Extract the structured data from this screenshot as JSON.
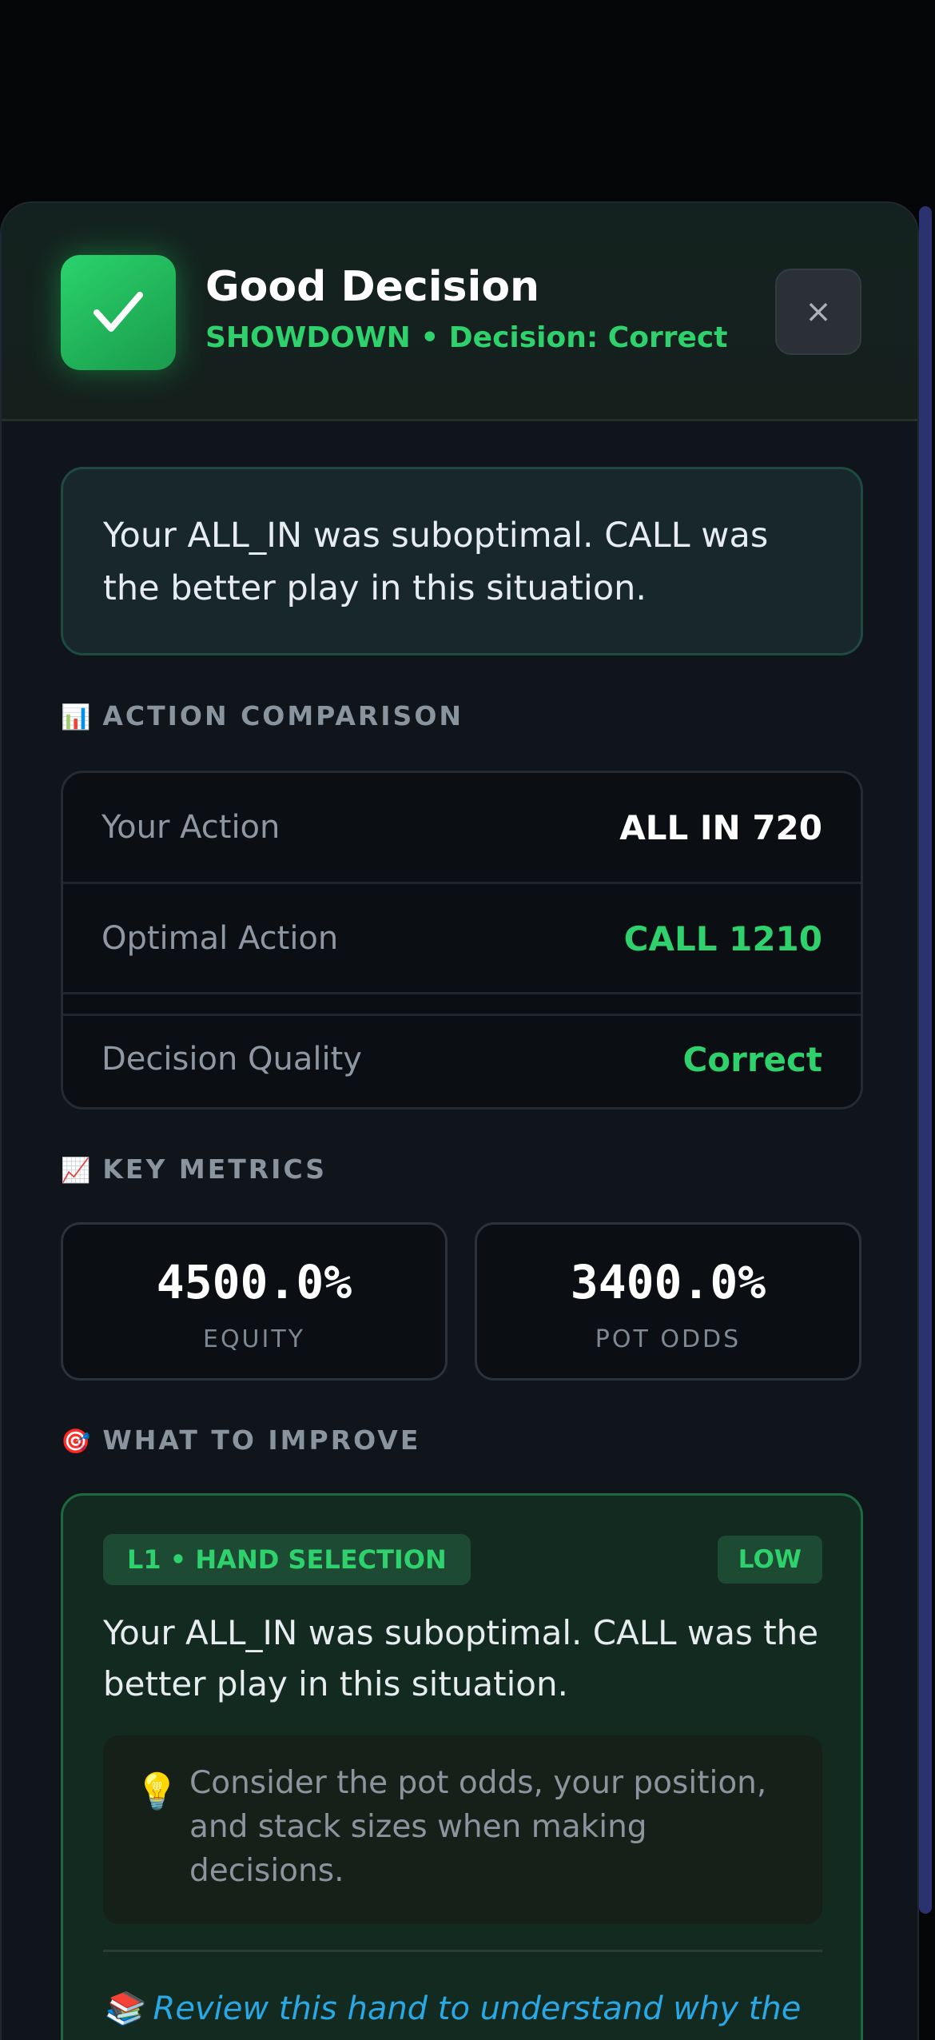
{
  "header": {
    "title": "Good Decision",
    "subtitle": "SHOWDOWN • Decision: Correct",
    "close_label": "×"
  },
  "summary": "Your ALL_IN was suboptimal. CALL was the better play in this situation.",
  "comparison": {
    "section_icon": "📊",
    "section_title": "ACTION COMPARISON",
    "rows": [
      {
        "label": "Your Action",
        "value": "ALL IN 720",
        "color": "#ffffff"
      },
      {
        "label": "Optimal Action",
        "value": "CALL 1210",
        "color": "#2fd16c"
      },
      {
        "label": "Decision Quality",
        "value": "Correct",
        "color": "#2fd16c"
      }
    ]
  },
  "metrics": {
    "section_icon": "📈",
    "section_title": "KEY METRICS",
    "items": [
      {
        "value": "4500.0%",
        "label": "EQUITY"
      },
      {
        "value": "3400.0%",
        "label": "POT ODDS"
      }
    ]
  },
  "improve": {
    "section_icon": "🎯",
    "section_title": "WHAT TO IMPROVE",
    "tag": "L1 • HAND SELECTION",
    "severity": "LOW",
    "text": "Your ALL_IN was suboptimal. CALL was the better play in this situation.",
    "tip_icon": "lightbulb-icon",
    "tip": "Consider the pot odds, your position, and stack sizes when making decisions.",
    "review_icon": "books-icon",
    "review": "Review this hand to understand why the optimal action was different."
  },
  "colors": {
    "accent_green": "#2fd16c",
    "background": "#10151b",
    "link_blue": "#2aa8e6"
  }
}
